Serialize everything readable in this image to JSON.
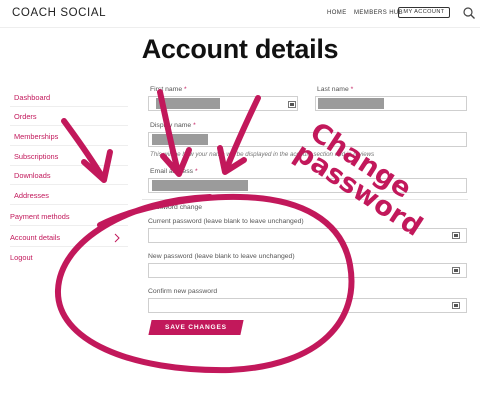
{
  "header": {
    "brand": "COACH SOCIAL",
    "nav": {
      "home": "HOME",
      "members_hub": "MEMBERS HUB",
      "my_account": "MY ACCOUNT"
    },
    "search_icon": "search-icon"
  },
  "page": {
    "title": "Account details"
  },
  "sidebar": {
    "items": [
      {
        "label": "Dashboard"
      },
      {
        "label": "Orders"
      },
      {
        "label": "Memberships"
      },
      {
        "label": "Subscriptions"
      },
      {
        "label": "Downloads"
      },
      {
        "label": "Addresses"
      },
      {
        "label": "Payment methods"
      },
      {
        "label": "Account details"
      },
      {
        "label": "Logout"
      }
    ]
  },
  "form": {
    "first_name_label": "First name",
    "last_name_label": "Last name",
    "display_name_label": "Display name",
    "display_name_help": "This will be how your name will be displayed in the account section and in reviews",
    "email_label": "Email address",
    "required_mark": "*",
    "password_legend": "Password change",
    "current_password_label": "Current password (leave blank to leave unchanged)",
    "new_password_label": "New password (leave blank to leave unchanged)",
    "confirm_password_label": "Confirm new password",
    "save_label": "SAVE CHANGES"
  },
  "annotation": {
    "text": "Change password",
    "color": "#c2185b"
  },
  "colors": {
    "accent": "#c2185b",
    "redaction": "#9b9b9b"
  }
}
